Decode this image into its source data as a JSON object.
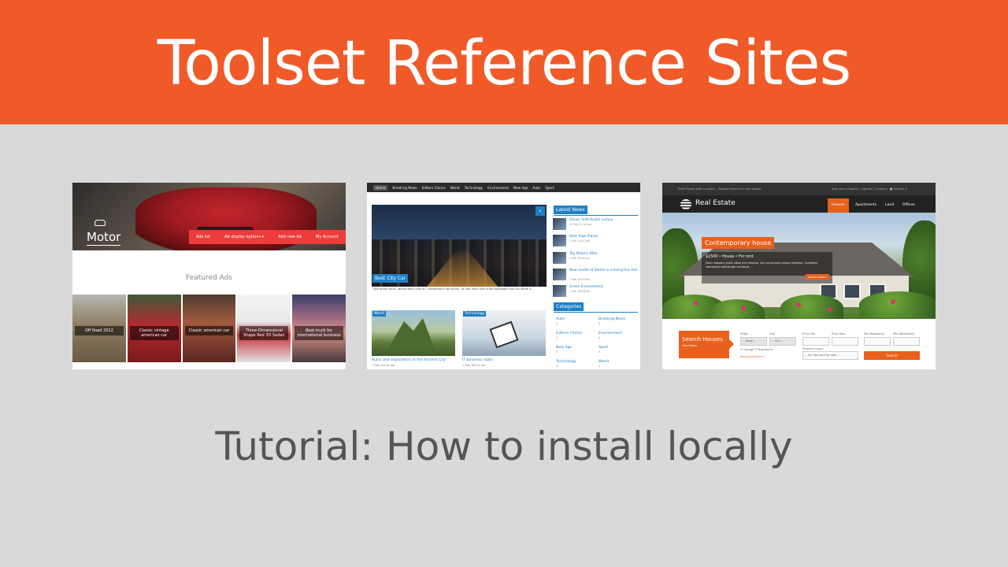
{
  "banner": {
    "title": "Toolset Reference Sites",
    "color": "#f05a28"
  },
  "subtitle": "Tutorial: How to install locally",
  "motor": {
    "logo": "Motor",
    "nav": [
      "Ads list",
      "Ad display options ▾",
      "Add new Ad",
      "My Account"
    ],
    "featured_heading": "Featured Ads",
    "ads": [
      "Off Road 2012",
      "Classic vintage american car",
      "Classic american car",
      "Three-Dimensional Shape Red 3D Sedan",
      "Best truck for international business"
    ],
    "accent": "#ee3b3b"
  },
  "news": {
    "nav": [
      "Home",
      "Breaking News",
      "Editors Choice",
      "World",
      "Technology",
      "Environment",
      "New Age",
      "Auto",
      "Sport"
    ],
    "featured_caption": "Best City Car",
    "featured_text": "Sed quam lacus, lacinia quis nulla eu, consectetur nec purus. Ut non nunc quis nulla vulputate nunc eu lorem a ...",
    "latest_heading": "Latest News",
    "latest": [
      {
        "title": "Donec Sollicitudin Luctus",
        "date": "25 Feb, 11:54 am"
      },
      {
        "title": "Best Yoga Places",
        "date": "3 Feb, 14:27 pm"
      },
      {
        "title": "Top Nature Sites",
        "date": "3 Feb, 09:36 am"
      },
      {
        "title": "New model of Sedan is coming this Fall",
        "date": "1 Feb, 08:53 am"
      },
      {
        "title": "Green Environment",
        "date": "1 Feb, 06:18 am"
      }
    ],
    "categories_heading": "Categories",
    "categories": [
      {
        "name": "Auto",
        "count": "5"
      },
      {
        "name": "Breaking News",
        "count": "5"
      },
      {
        "name": "Editors Choice",
        "count": "5"
      },
      {
        "name": "Environment",
        "count": "4"
      },
      {
        "name": "New Age",
        "count": "5"
      },
      {
        "name": "Sport",
        "count": "5"
      },
      {
        "name": "Technology",
        "count": "5"
      },
      {
        "name": "World",
        "count": "5"
      }
    ],
    "articles": [
      {
        "tag": "World",
        "title": "Ruins and exploration in the Ancient City",
        "date": "1 Feb, 04:21 am"
      },
      {
        "tag": "Technology",
        "title": "IT business stats",
        "date": "1 Feb, 06:11 am"
      }
    ],
    "accent": "#1e7fc6"
  },
  "realestate": {
    "top_left": "Real Estate with Layouts – Toolset theme for real estate",
    "top_right": "Add your property  |  Agents  |  Contact  |  ■ English ▾",
    "logo": "Real Estate",
    "nav": [
      "Houses",
      "Apartments",
      "Land",
      "Offices"
    ],
    "hero_title": "Contemporary house",
    "hero_price": "$1500 • House • For rent",
    "hero_desc": "Nunc aliquam justo vitae nisl tempus, nec accumsan neque tristique. Curabitur commodo sollicitudin tincidunt ...",
    "hero_button": "Learn more ›",
    "search_title": "Search Houses",
    "search_sub": "Use filters",
    "labels": {
      "state": "State",
      "city": "City",
      "price_min": "Price Min",
      "price_max": "Price Max",
      "min_bedrooms": "Min Bedrooms",
      "min_bathrooms": "Min Bathrooms",
      "property_types": "Property types",
      "garage": "☐ Garage  ☐ Basement",
      "advanced": "Advanced search ›"
    },
    "state_value": "-- State --",
    "city_value": "-- City --",
    "property_value": "-- For rent and for sale --",
    "search_button": "Search",
    "accent": "#e8601c"
  }
}
